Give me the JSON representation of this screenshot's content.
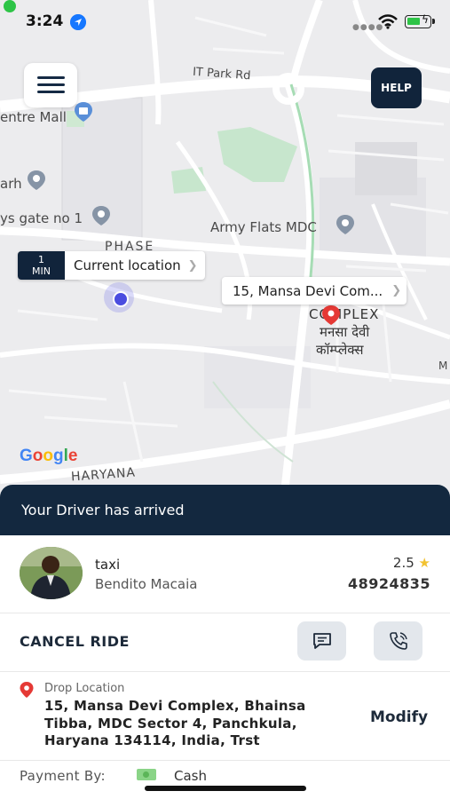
{
  "status_bar": {
    "time": "3:24"
  },
  "map": {
    "labels": {
      "it_park_rd": "IT Park Rd",
      "centre_mall": "entre Mall",
      "arh": "arh",
      "ys_gate": "ys gate no 1",
      "army_flats": "Army Flats MDC",
      "phase": "PHASE",
      "complex_en": "COMPLEX",
      "complex_hi_1": "मनसा देवी",
      "complex_hi_2": "कॉम्प्लेक्स",
      "haryana": "HARYANA",
      "m": "M"
    },
    "google_letters": [
      "G",
      "o",
      "o",
      "g",
      "l",
      "e"
    ],
    "google_colors": [
      "#4285F4",
      "#EA4335",
      "#FBBC05",
      "#4285F4",
      "#34A853",
      "#EA4335"
    ],
    "eta_value": "1",
    "eta_unit": "MIN",
    "current_location_label": "Current location",
    "destination_callout": "15,  Mansa Devi Com..."
  },
  "controls": {
    "help_label": "HELP"
  },
  "ride": {
    "status_banner": "Your Driver has arrived",
    "driver": {
      "vehicle_type": "taxi",
      "name": "Bendito Macaia",
      "rating": "2.5",
      "phone": "48924835"
    },
    "cancel_label": "CANCEL RIDE",
    "drop_label": "Drop Location",
    "drop_address": "15,  Mansa Devi Complex,  Bhainsa Tibba, MDC Sector 4, Panchkula, Haryana 134114, India,  Trst",
    "modify_label": "Modify",
    "payment_label": "Payment By:",
    "payment_method": "Cash"
  },
  "colors": {
    "primary": "#13283f",
    "accent_green": "#2ec447",
    "pin_red": "#e53935",
    "star": "#f2c230"
  }
}
